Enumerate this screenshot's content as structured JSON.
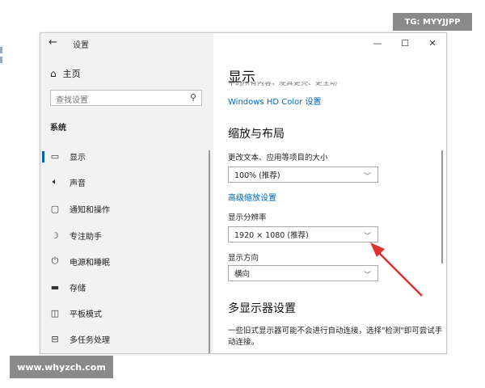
{
  "window": {
    "title": "设置",
    "controls": {
      "minimize": "—",
      "maximize": "☐",
      "close": "✕"
    }
  },
  "sidebar": {
    "home_label": "主页",
    "search_placeholder": "查找设置",
    "section": "系统",
    "items": [
      {
        "label": "显示",
        "icon": "monitor-icon",
        "active": true
      },
      {
        "label": "声音",
        "icon": "speaker-icon"
      },
      {
        "label": "通知和操作",
        "icon": "notification-icon"
      },
      {
        "label": "专注助手",
        "icon": "moon-icon"
      },
      {
        "label": "电源和睡眠",
        "icon": "power-icon"
      },
      {
        "label": "存储",
        "icon": "storage-icon"
      },
      {
        "label": "平板模式",
        "icon": "tablet-icon"
      },
      {
        "label": "多任务处理",
        "icon": "multitask-icon"
      }
    ]
  },
  "content": {
    "title": "显示",
    "clipped_text": "中的所有内容，使其更亮、更生动",
    "hd_link": "Windows HD Color 设置",
    "scale_heading": "缩放与布局",
    "scale_label": "更改文本、应用等项目的大小",
    "scale_value": "100% (推荐)",
    "advanced_scaling_link": "高级缩放设置",
    "resolution_label": "显示分辨率",
    "resolution_value": "1920 × 1080 (推荐)",
    "orientation_label": "显示方向",
    "orientation_value": "横向",
    "multi_heading": "多显示器设置",
    "multi_desc": "一些旧式显示器可能不会进行自动连接，选择\"检测\"即可尝试手动连接。"
  },
  "watermarks": {
    "top": "TG: MYYJJPP",
    "bottom": "www.whyzch.com"
  },
  "colors": {
    "accent": "#0067b8",
    "arrow": "#e03030"
  }
}
